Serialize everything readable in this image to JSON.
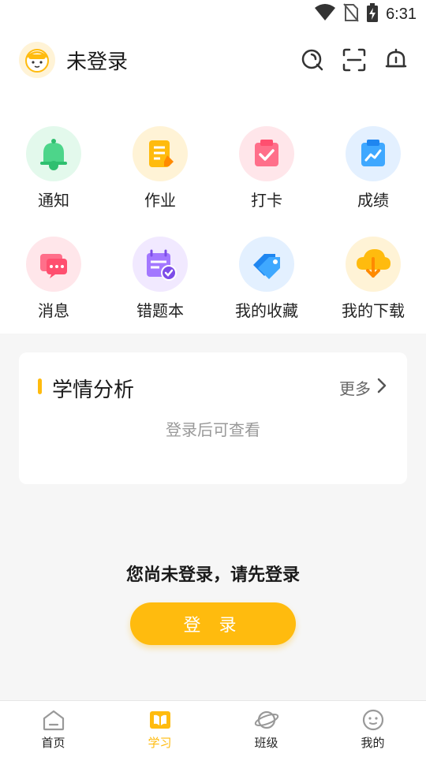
{
  "status_bar": {
    "time": "6:31",
    "icons": [
      "wifi-icon",
      "no-sim-icon",
      "battery-charging-icon"
    ]
  },
  "header": {
    "user_name": "未登录",
    "icons": [
      "search-icon",
      "scan-icon",
      "bell-icon"
    ]
  },
  "grid": [
    {
      "label": "通知",
      "icon": "notification-bell-icon",
      "bg": "#e3f9ec"
    },
    {
      "label": "作业",
      "icon": "homework-icon",
      "bg": "#fff3d6"
    },
    {
      "label": "打卡",
      "icon": "check-in-icon",
      "bg": "#ffe6ea"
    },
    {
      "label": "成绩",
      "icon": "grades-icon",
      "bg": "#e3f0ff"
    },
    {
      "label": "消息",
      "icon": "message-icon",
      "bg": "#ffe6ea"
    },
    {
      "label": "错题本",
      "icon": "mistake-book-icon",
      "bg": "#f1e9ff"
    },
    {
      "label": "我的收藏",
      "icon": "favorites-icon",
      "bg": "#e3f0ff"
    },
    {
      "label": "我的下载",
      "icon": "download-icon",
      "bg": "#fff3d6"
    }
  ],
  "analysis": {
    "title": "学情分析",
    "more": "更多",
    "hint": "登录后可查看"
  },
  "login": {
    "prompt": "您尚未登录，请先登录",
    "button": "登 录"
  },
  "bottom_nav": [
    {
      "label": "首页",
      "icon": "home-icon",
      "active": false
    },
    {
      "label": "学习",
      "icon": "study-book-icon",
      "active": true
    },
    {
      "label": "班级",
      "icon": "class-planet-icon",
      "active": false
    },
    {
      "label": "我的",
      "icon": "profile-face-icon",
      "active": false
    }
  ],
  "colors": {
    "accent": "#ffbb0e",
    "text": "#1a1a1a",
    "muted": "#999999"
  }
}
